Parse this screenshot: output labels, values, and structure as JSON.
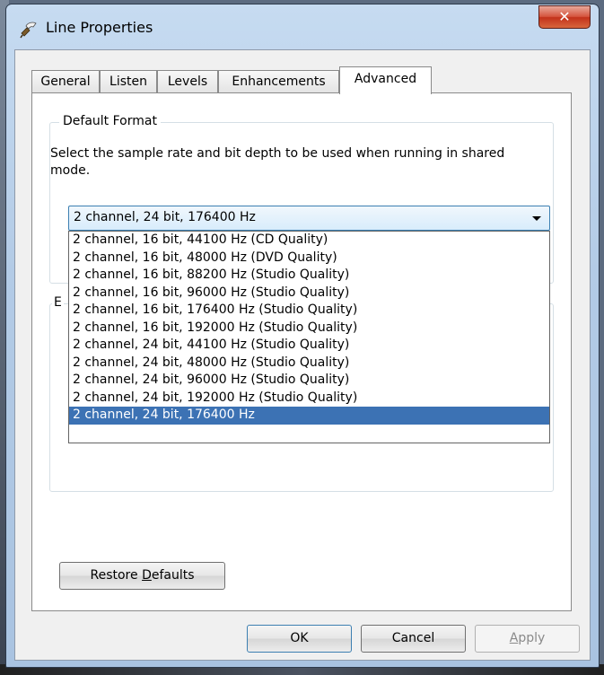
{
  "window": {
    "title": "Line Properties",
    "close_glyph": "✕",
    "icon": "speaker-line-icon"
  },
  "tabs": [
    {
      "label": "General"
    },
    {
      "label": "Listen"
    },
    {
      "label": "Levels"
    },
    {
      "label": "Enhancements"
    },
    {
      "label": "Advanced",
      "active": true
    }
  ],
  "default_format": {
    "group_title": "Default Format",
    "description": "Select the sample rate and bit depth to be used when running in shared mode.",
    "selected": "2 channel, 24 bit, 176400 Hz",
    "options": [
      "2 channel, 16 bit, 44100 Hz (CD Quality)",
      "2 channel, 16 bit, 48000 Hz (DVD Quality)",
      "2 channel, 16 bit, 88200 Hz (Studio Quality)",
      "2 channel, 16 bit, 96000 Hz (Studio Quality)",
      "2 channel, 16 bit, 176400 Hz (Studio Quality)",
      "2 channel, 16 bit, 192000 Hz (Studio Quality)",
      "2 channel, 24 bit, 44100 Hz (Studio Quality)",
      "2 channel, 24 bit, 48000 Hz (Studio Quality)",
      "2 channel, 24 bit, 96000 Hz (Studio Quality)",
      "2 channel, 24 bit, 192000 Hz (Studio Quality)",
      "2 channel, 24 bit, 176400 Hz"
    ],
    "highlighted_index": 10
  },
  "exclusive_group": {
    "title_fragment": "E"
  },
  "buttons": {
    "restore_prefix": "Restore ",
    "restore_accel": "D",
    "restore_suffix": "efaults",
    "ok": "OK",
    "cancel": "Cancel",
    "apply_accel": "A",
    "apply_suffix": "pply"
  },
  "colors": {
    "selection": "#3c72b4",
    "close_button": "#c2321b",
    "window_frame": "#b3cbe6"
  }
}
